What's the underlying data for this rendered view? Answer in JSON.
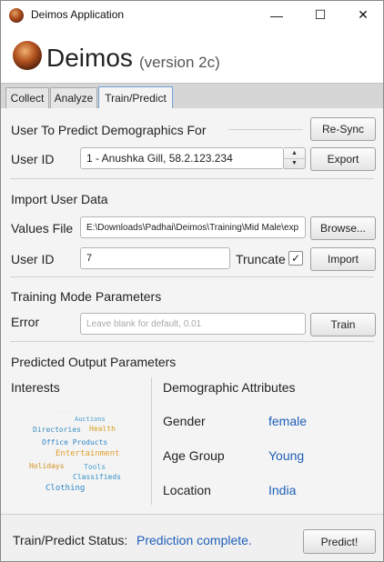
{
  "window": {
    "title": "Deimos Application",
    "controls": {
      "minimize": "—",
      "maximize": "☐",
      "close": "✕"
    }
  },
  "header": {
    "app_name": "Deimos",
    "version": "(version 2c)"
  },
  "tabs": [
    {
      "label": "Collect"
    },
    {
      "label": "Analyze"
    },
    {
      "label": "Train/Predict",
      "active": true
    }
  ],
  "predict_user": {
    "title": "User To Predict Demographics For",
    "resync_label": "Re-Sync",
    "user_id_label": "User ID",
    "user_id_value": "1 - Anushka Gill, 58.2.123.234",
    "export_label": "Export"
  },
  "import": {
    "title": "Import User Data",
    "values_file_label": "Values File",
    "values_file_value": "E:\\Downloads\\Padhai\\Deimos\\Training\\Mid Male\\exp",
    "browse_label": "Browse...",
    "user_id_label": "User ID",
    "user_id_value": "7",
    "truncate_label": "Truncate",
    "truncate_checked": true,
    "checkbox_mark": "✓",
    "import_label": "Import"
  },
  "training": {
    "title": "Training Mode Parameters",
    "error_label": "Error",
    "error_placeholder": "Leave blank for default, 0.01",
    "train_label": "Train"
  },
  "output": {
    "title": "Predicted Output Parameters",
    "interests_label": "Interests",
    "interest_words": [
      "Auctions",
      "Directories",
      "Health",
      "Office Products",
      "Entertainment",
      "Holidays",
      "Tools",
      "Classifieds",
      "Clothing"
    ],
    "demographics_label": "Demographic Attributes",
    "attributes": [
      {
        "label": "Gender",
        "value": "female"
      },
      {
        "label": "Age Group",
        "value": "Young"
      },
      {
        "label": "Location",
        "value": "India"
      }
    ]
  },
  "status": {
    "label": "Train/Predict Status:",
    "value": "Prediction complete.",
    "predict_label": "Predict!"
  },
  "colors": {
    "accent": "#1f5fb8",
    "tab_active_border": "#6fa3d8"
  }
}
